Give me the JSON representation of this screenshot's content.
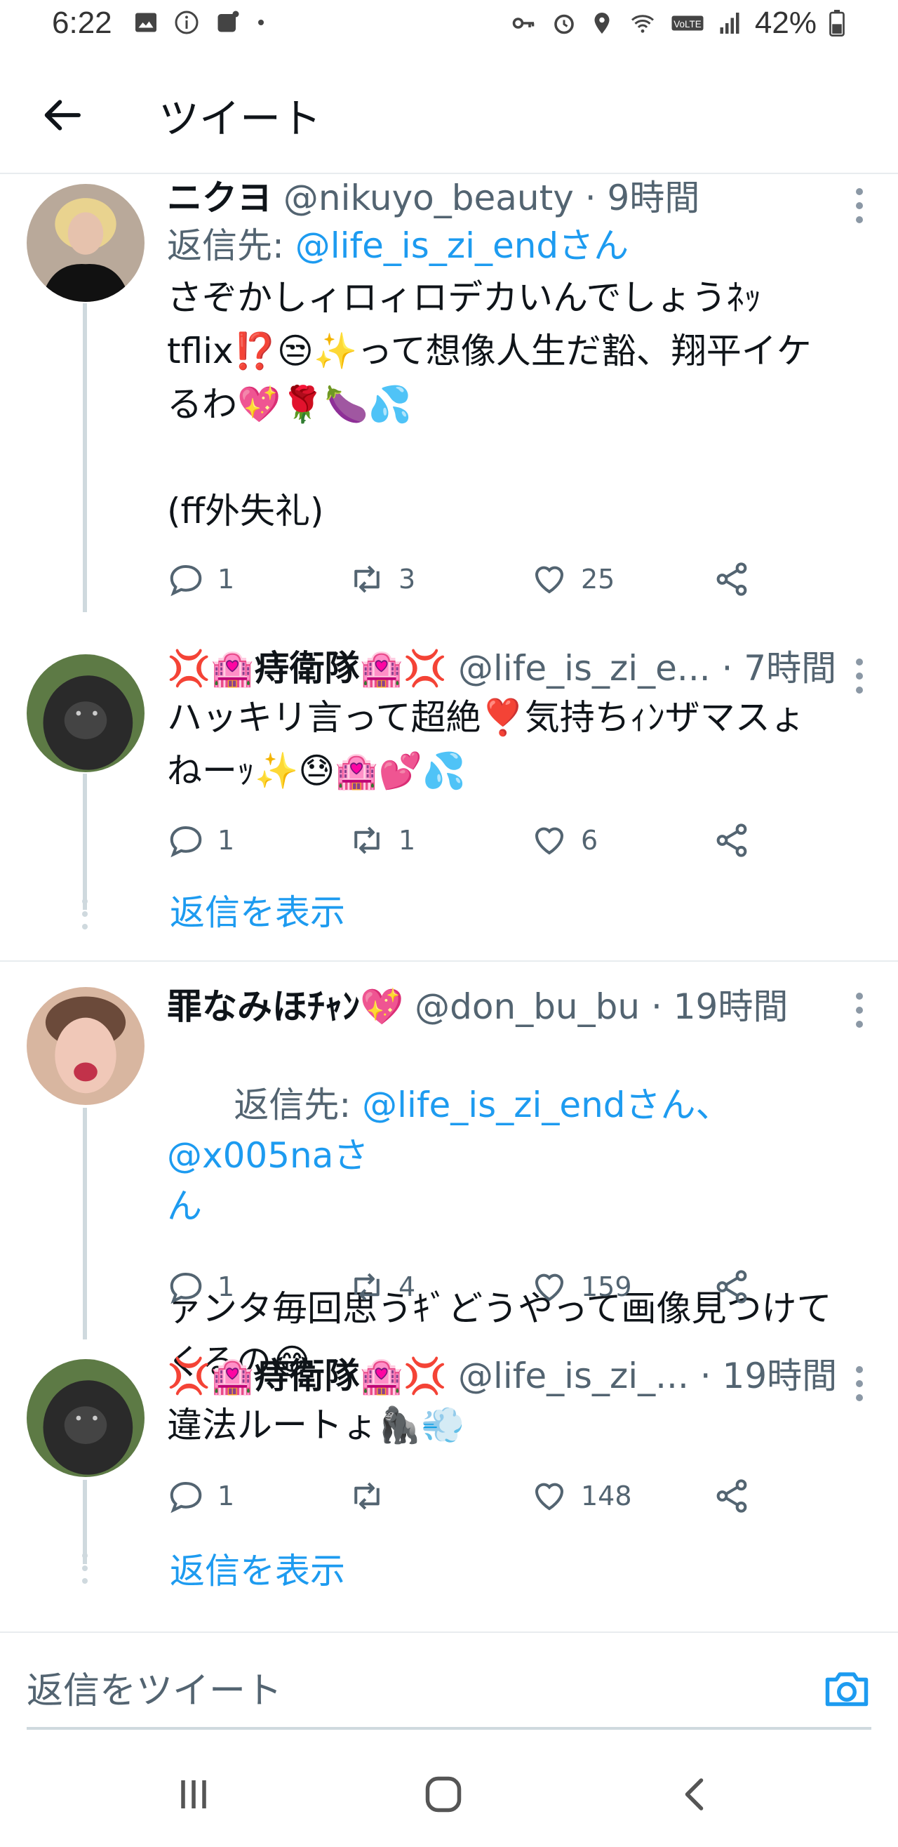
{
  "status_bar": {
    "time": "6:22",
    "battery": "42%",
    "icons_left": [
      "gallery-icon",
      "info-icon",
      "app-notification-icon",
      "dot-icon"
    ],
    "icons_right": [
      "key-icon",
      "alarm-icon",
      "location-icon",
      "wifi-icon",
      "volte-icon",
      "signal-icon",
      "battery-icon"
    ]
  },
  "header": {
    "title": "ツイート",
    "back_icon": "arrow-left-icon"
  },
  "colors": {
    "link": "#1d9bf0",
    "muted": "#536471",
    "line": "#cfd9de"
  },
  "tweets": [
    {
      "name": "ニクヨ",
      "handle": "@nikuyo_beauty",
      "time": "· 9時間",
      "reply_label": "返信先: ",
      "reply_to": "@life_is_zi_endさん",
      "text": "さぞかしィロィロデカいんでしょうﾈｯ\ntflix⁉️😒✨って想像人生だ豁、翔平イケ\nるわ💖🌹🍆💦\n\n(ff外失礼)",
      "replies": "1",
      "retweets": "3",
      "likes": "25"
    },
    {
      "name": "💢🏩痔衛隊🏩💢",
      "handle": "@life_is_zi_e...",
      "time": "· 7時間",
      "text": "ハッキリ言って超絶❣️気持ちｨﾝザマスょ\nねーｯ✨😓🏩💕💦",
      "replies": "1",
      "retweets": "1",
      "likes": "6",
      "show_replies": "返信を表示"
    },
    {
      "name": "罪なみほﾁｬﾝ💖",
      "handle": "@don_bu_bu",
      "time": "· 19時間",
      "reply_label": "返信先: ",
      "reply_to": "@life_is_zi_endさん、@x005naさ\nん",
      "text": "ァンタ毎回思うｷﾞどうやって画像見つけて\nくるの😂",
      "replies": "1",
      "retweets": "4",
      "likes": "159"
    },
    {
      "name": "💢🏩痔衛隊🏩💢",
      "handle": "@life_is_zi_...",
      "time": "· 19時間",
      "text": "違法ルートょ🦍💨",
      "replies": "1",
      "retweets": "",
      "likes": "148",
      "show_replies": "返信を表示"
    }
  ],
  "reply_box": {
    "placeholder": "返信をツイート",
    "camera_icon": "camera-icon"
  },
  "navbar": {
    "buttons": [
      "recent-apps-icon",
      "home-icon",
      "back-icon"
    ]
  }
}
